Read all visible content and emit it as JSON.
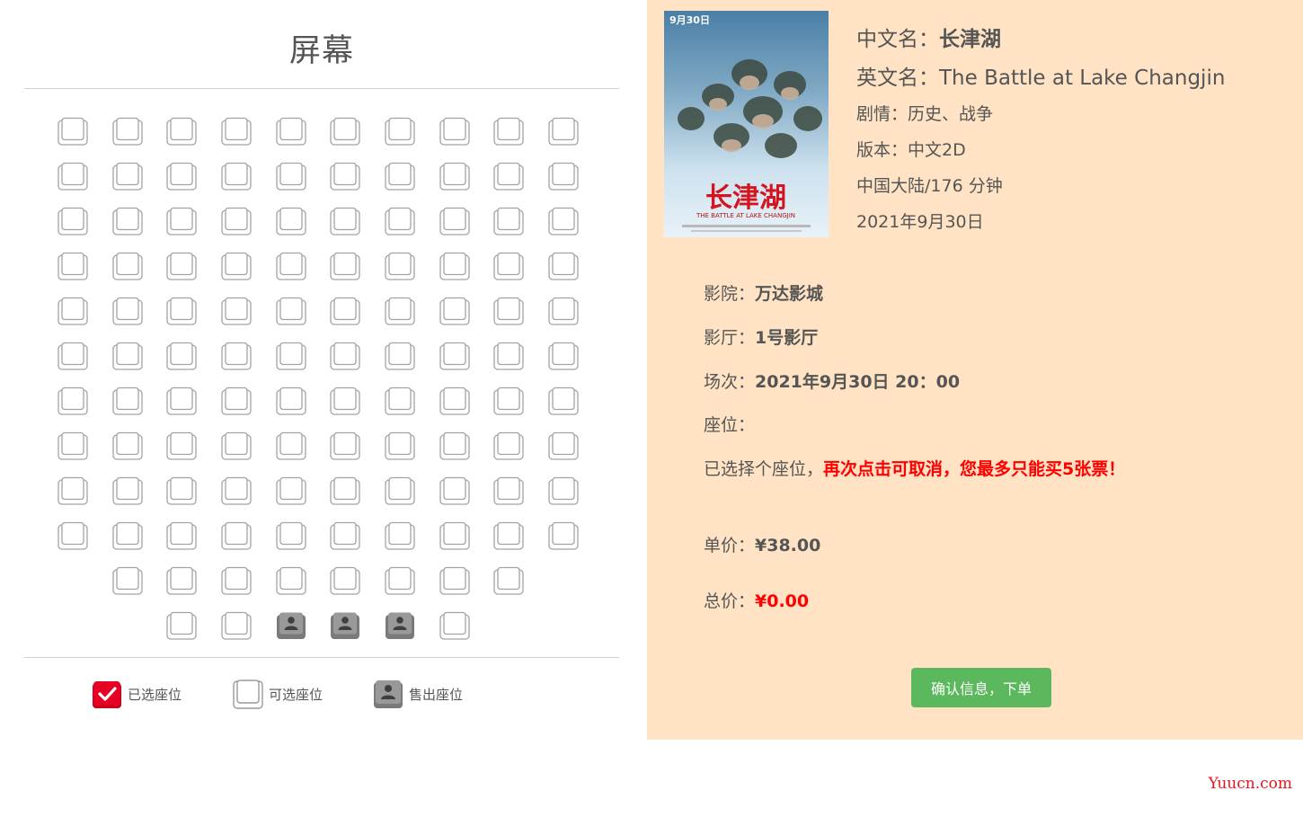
{
  "screen": {
    "title": "屏幕"
  },
  "seats": {
    "rows": [
      {
        "count": 10,
        "sold": []
      },
      {
        "count": 10,
        "sold": []
      },
      {
        "count": 10,
        "sold": []
      },
      {
        "count": 10,
        "sold": []
      },
      {
        "count": 10,
        "sold": []
      },
      {
        "count": 10,
        "sold": []
      },
      {
        "count": 10,
        "sold": []
      },
      {
        "count": 10,
        "sold": []
      },
      {
        "count": 10,
        "sold": []
      },
      {
        "count": 10,
        "sold": []
      },
      {
        "count": 8,
        "sold": []
      },
      {
        "count": 6,
        "sold": [
          2,
          3,
          4
        ]
      }
    ]
  },
  "legend": {
    "selected": "已选座位",
    "available": "可选座位",
    "sold": "售出座位"
  },
  "movie": {
    "poster": {
      "date_text": "9月30日",
      "title_text": "长津湖",
      "subtitle_text": "THE BATTLE AT LAKE CHANGJIN"
    },
    "cn_name_label": "中文名：",
    "cn_name": "长津湖",
    "en_name_label": "英文名：",
    "en_name": "The Battle at Lake Changjin",
    "genre": "剧情：历史、战争",
    "version": "版本：中文2D",
    "region_duration": "中国大陆/176 分钟",
    "release_date": "2021年9月30日"
  },
  "order": {
    "cinema_label": "影院：",
    "cinema": "万达影城",
    "hall_label": "影厅：",
    "hall": "1号影厅",
    "session_label": "场次：",
    "session": "2021年9月30日 20：00",
    "seat_label": "座位：",
    "seat_value": "",
    "selected_text": "已选择个座位，",
    "warning_text": "再次点击可取消，您最多只能买5张票！",
    "unit_price_label": "单价：",
    "unit_price": "¥38.00",
    "total_label": "总价：",
    "total": "¥0.00"
  },
  "confirm_button": "确认信息，下单",
  "watermark": "Yuucn.com",
  "colors": {
    "panel_bg": "#ffe3c4",
    "confirm_bg": "#5cb85c",
    "selected_red": "#e60023",
    "warning_red": "#ff0000",
    "sold_gray": "#8f8f8f"
  }
}
